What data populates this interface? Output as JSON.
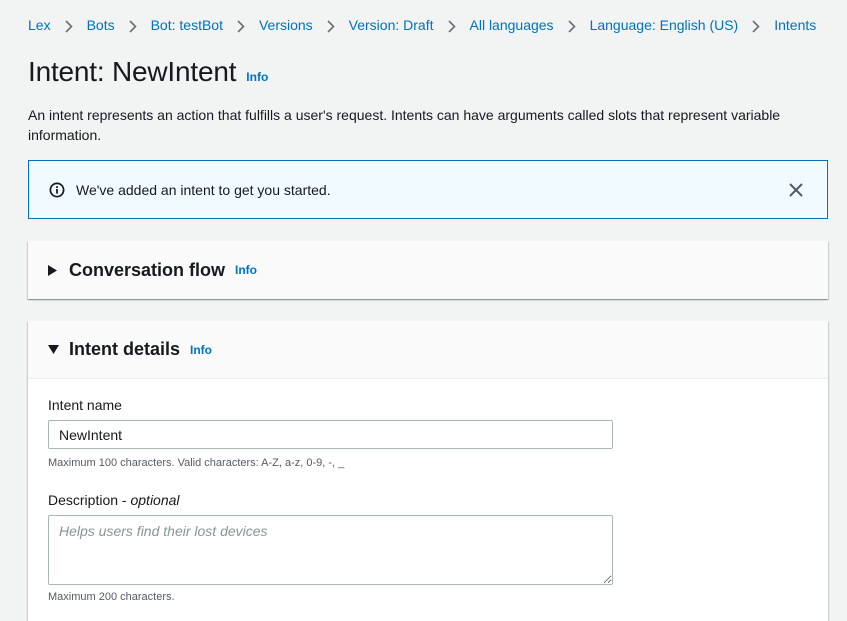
{
  "breadcrumb": [
    {
      "label": "Lex"
    },
    {
      "label": "Bots"
    },
    {
      "label": "Bot: testBot"
    },
    {
      "label": "Versions"
    },
    {
      "label": "Version: Draft"
    },
    {
      "label": "All languages"
    },
    {
      "label": "Language: English (US)"
    },
    {
      "label": "Intents"
    }
  ],
  "page": {
    "title": "Intent: NewIntent",
    "info_label": "Info",
    "description": "An intent represents an action that fulfills a user's request. Intents can have arguments called slots that represent variable information."
  },
  "flash": {
    "message": "We've added an intent to get you started.",
    "icon": "info-icon",
    "close_icon": "close-icon"
  },
  "conversation_flow": {
    "title": "Conversation flow",
    "info_label": "Info",
    "expanded": false
  },
  "intent_details": {
    "title": "Intent details",
    "info_label": "Info",
    "expanded": true,
    "intent_name": {
      "label": "Intent name",
      "value": "NewIntent",
      "hint": "Maximum 100 characters. Valid characters: A-Z, a-z, 0-9, -, _"
    },
    "description": {
      "label": "Description",
      "label_suffix": "optional",
      "placeholder": "Helps users find their lost devices",
      "value": "",
      "hint": "Maximum 200 characters."
    }
  },
  "colors": {
    "link": "#0073bb",
    "background": "#f2f3f3",
    "flash_background": "#f1faff"
  }
}
